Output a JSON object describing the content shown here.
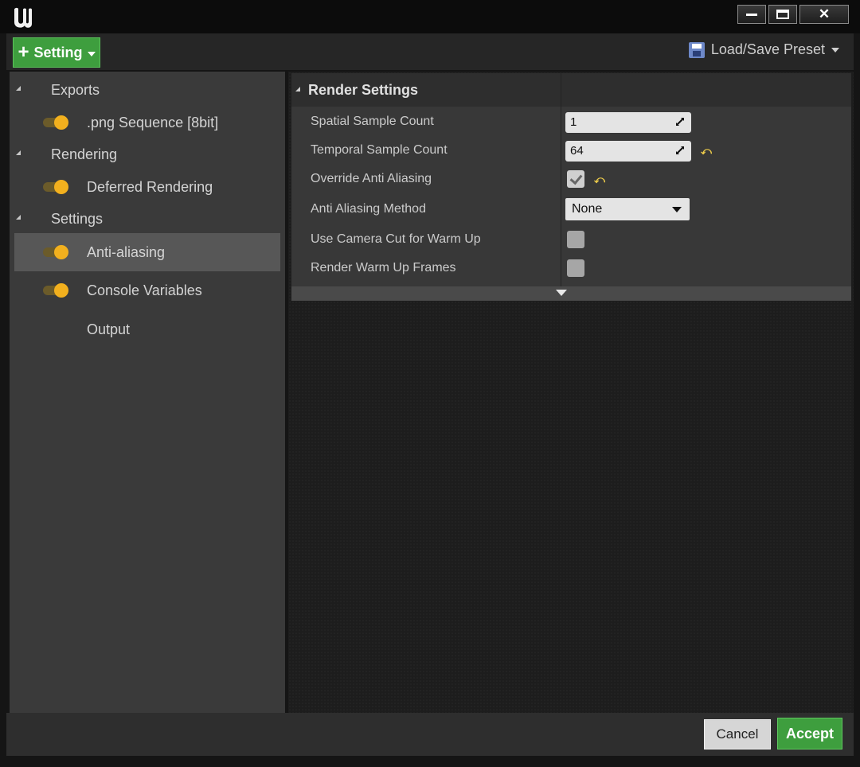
{
  "window": {
    "logo_icon": "unreal-logo-icon",
    "buttons": [
      "minimize-icon",
      "maximize-icon",
      "close-icon"
    ],
    "close_glyph": "✕"
  },
  "toolbar": {
    "setting_label": "Setting",
    "preset_label": "Load/Save Preset"
  },
  "sidebar": {
    "items": [
      {
        "label": "Exports",
        "type": "group"
      },
      {
        "label": ".png Sequence [8bit]",
        "type": "setting",
        "enabled": true
      },
      {
        "label": "Rendering",
        "type": "group"
      },
      {
        "label": "Deferred Rendering",
        "type": "setting",
        "enabled": true
      },
      {
        "label": "Settings",
        "type": "group"
      },
      {
        "label": "Anti-aliasing",
        "type": "setting",
        "enabled": true,
        "selected": true
      },
      {
        "label": "Console Variables",
        "type": "setting",
        "enabled": true
      },
      {
        "label": "Output",
        "type": "setting"
      }
    ]
  },
  "details": {
    "section_title": "Render Settings",
    "properties": [
      {
        "label": "Spatial Sample Count",
        "value": "1"
      },
      {
        "label": "Temporal Sample Count",
        "value": "64",
        "reset": "⤺"
      },
      {
        "label": "Override Anti Aliasing",
        "checked": true,
        "reset": "⤺"
      },
      {
        "label": "Anti Aliasing Method",
        "value": "None"
      },
      {
        "label": "Use Camera Cut for Warm Up",
        "checked": false
      },
      {
        "label": "Render Warm Up Frames",
        "checked": false
      }
    ]
  },
  "footer": {
    "cancel_label": "Cancel",
    "accept_label": "Accept"
  },
  "colors": {
    "accent_green": "#3e9e3e",
    "toggle_yellow": "#f2b01e",
    "reset_yellow": "#f2d04b"
  }
}
